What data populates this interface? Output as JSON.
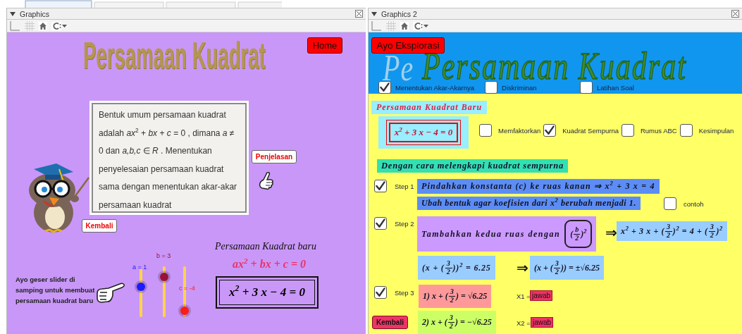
{
  "left_panel": {
    "title": "Graphics",
    "heading": "Persamaan Kuadrat",
    "home_button": "Home",
    "definition": "Bentuk umum persamaan kuadrat adalah *ax*$^{2}$ + *bx* + *c* = 0 , dimana *a* ≠ 0 dan *a,b,c* ∈ *R* . Menentukan penyelesaian persamaan kuadrat sama dengan menentukan akar-akar persamaan kuadrat",
    "explain_button": "Penjelasan",
    "back_button": "Kembali",
    "slider_hint": "Ayo geser slider di samping untuk membuat persamaan kuadrat baru",
    "sliders": [
      {
        "label": "a = 1",
        "level": 0.63,
        "color": "#1a1aff"
      },
      {
        "label": "b = 3",
        "level": 0.79,
        "color": "#99113a"
      },
      {
        "label": "c = -4",
        "level": 0.12,
        "color": "#ff1a1a"
      }
    ],
    "new_equation_title": "Persamaan Kuadrat baru",
    "general_form": [
      {
        "kind": "text",
        "text": "ax$^{2}$ + bx + c = 0"
      }
    ],
    "equation": [
      {
        "kind": "text",
        "text": "x$^{2}$ + 3 x − 4 = 0"
      }
    ]
  },
  "right_panel": {
    "title": "Graphics 2",
    "explore_button": "Ayo Eksplorasi",
    "banner_shadow": "Pe",
    "banner_title": "Persamaan Kuadrat",
    "topics": [
      {
        "label": "Menentukan Akar-Akarnya",
        "checked": true
      },
      {
        "label": "Diskriminan",
        "checked": false
      },
      {
        "label": "Latihan Soal",
        "checked": false
      }
    ],
    "new_equation_label": "Persamaan Kuadrat Baru",
    "equation": [
      {
        "kind": "text",
        "text": "x$^{2}$ + 3 x − 4 = 0"
      }
    ],
    "methods": [
      {
        "label": "Memfaktorkan",
        "checked": false
      },
      {
        "label": "Kuadrat Sempurna",
        "checked": true
      },
      {
        "label": "Rumus ABC",
        "checked": false
      },
      {
        "label": "Kesimpulan",
        "checked": false
      }
    ],
    "method_heading": "Dengan cara melengkapi kuadrat sempurna",
    "step1": {
      "label": "Step 1",
      "checked": true,
      "instruction": [
        {
          "kind": "text",
          "text": "Pindahkan konstanta (c) ke ruas kanan ⇒ x$^{2}$ + 3 x = 4"
        }
      ],
      "note": [
        {
          "kind": "text",
          "text": "Ubah bentuk agar koefisien dari x$^{2}$ berubah menjadi 1."
        }
      ],
      "example": {
        "label": "contoh",
        "checked": false
      }
    },
    "step2": {
      "label": "Step 2",
      "checked": true,
      "instruction": "Tambahkan kedua ruas dengan",
      "term": [
        {
          "kind": "text",
          "text": "("
        },
        {
          "kind": "frac",
          "num": "b",
          "den": "2"
        },
        {
          "kind": "text",
          "text": ")$^{2}$"
        }
      ],
      "arrow": "⇒",
      "result": [
        {
          "kind": "text",
          "text": "x$^{2}$ + 3 x + ("
        },
        {
          "kind": "frac",
          "num": "3",
          "den": "2"
        },
        {
          "kind": "text",
          "text": ")$^{2}$ = 4 + ("
        },
        {
          "kind": "frac",
          "num": "3",
          "den": "2"
        },
        {
          "kind": "text",
          "text": ")$^{2}$"
        }
      ],
      "square_form": [
        {
          "kind": "text",
          "text": "(x + ("
        },
        {
          "kind": "frac",
          "num": "3",
          "den": "2"
        },
        {
          "kind": "text",
          "text": "))$^{2}$ = 6.25"
        }
      ],
      "arrow2": "⇒",
      "root_form": [
        {
          "kind": "text",
          "text": "(x + ("
        },
        {
          "kind": "frac",
          "num": "3",
          "den": "2"
        },
        {
          "kind": "text",
          "text": ")) = ±√6.25"
        }
      ]
    },
    "step3": {
      "label": "Step 3",
      "checked": true,
      "root1": [
        {
          "kind": "text",
          "text": "1) x + ("
        },
        {
          "kind": "frac",
          "num": "3",
          "den": "2"
        },
        {
          "kind": "text",
          "text": ") = √6.25"
        }
      ],
      "x1_label": "X1 =",
      "x1_value": "jawab",
      "root2": [
        {
          "kind": "text",
          "text": "2) x + ("
        },
        {
          "kind": "frac",
          "num": "3",
          "den": "2"
        },
        {
          "kind": "text",
          "text": ") = −√6.25"
        }
      ],
      "x2_label": "X2 =",
      "x2_value": "jawab"
    },
    "back_button": "Kembali"
  }
}
